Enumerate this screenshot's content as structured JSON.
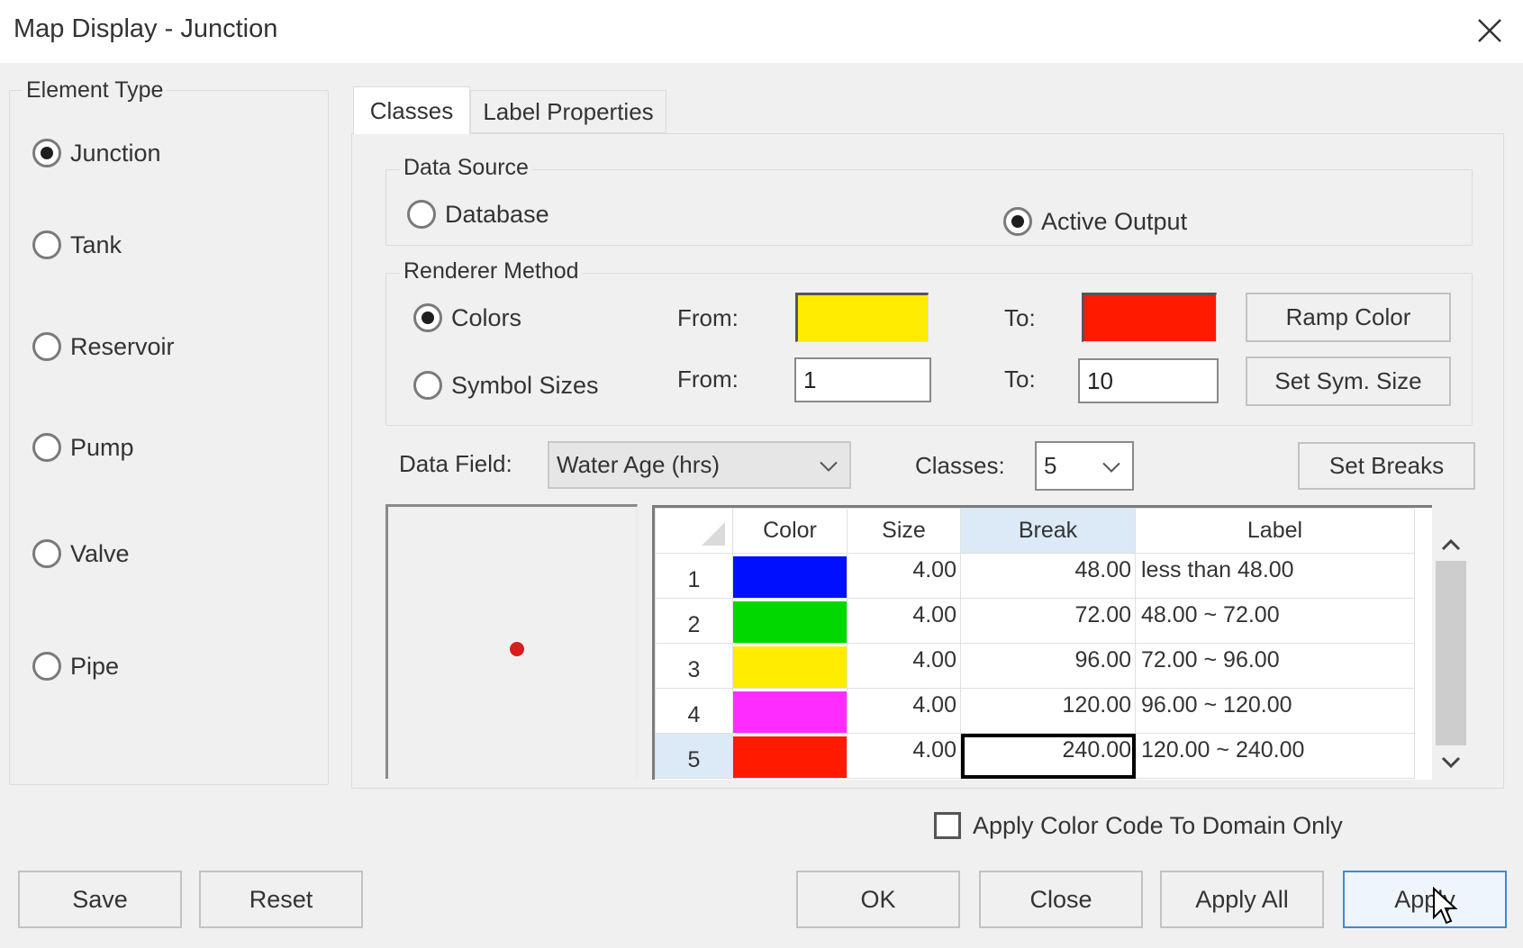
{
  "window": {
    "title": "Map Display  - Junction",
    "close_icon": "close-icon"
  },
  "element_type": {
    "label": "Element Type",
    "options": [
      {
        "label": "Junction",
        "checked": true
      },
      {
        "label": "Tank",
        "checked": false
      },
      {
        "label": "Reservoir",
        "checked": false
      },
      {
        "label": "Pump",
        "checked": false
      },
      {
        "label": "Valve",
        "checked": false
      },
      {
        "label": "Pipe",
        "checked": false
      }
    ]
  },
  "tabs": [
    {
      "label": "Classes",
      "active": true
    },
    {
      "label": "Label Properties",
      "active": false
    }
  ],
  "data_source": {
    "label": "Data Source",
    "options": [
      {
        "label": "Database",
        "checked": false
      },
      {
        "label": "Active Output",
        "checked": true
      }
    ]
  },
  "renderer": {
    "label": "Renderer Method",
    "colors_label": "Colors",
    "colors_checked": true,
    "symbol_sizes_label": "Symbol Sizes",
    "symbol_sizes_checked": false,
    "from_label": "From:",
    "to_label": "To:",
    "color_from": "#ffec00",
    "color_to": "#ff1a00",
    "size_from": "1",
    "size_to": "10",
    "ramp_color_button": "Ramp Color",
    "set_sym_size_button": "Set Sym. Size"
  },
  "data_field": {
    "label": "Data Field:",
    "value": "Water Age (hrs)"
  },
  "classes": {
    "label": "Classes:",
    "value": "5",
    "set_breaks_button": "Set Breaks"
  },
  "preview": {
    "symbol_color": "#d81d1d"
  },
  "grid": {
    "columns": [
      "",
      "Color",
      "Size",
      "Break",
      "Label"
    ],
    "selected_column": "Break",
    "selected_row": 5,
    "rows": [
      {
        "index": "1",
        "color": "#0010ff",
        "size": "4.00",
        "break": "48.00",
        "label": "less than 48.00"
      },
      {
        "index": "2",
        "color": "#00d800",
        "size": "4.00",
        "break": "72.00",
        "label": "48.00 ~ 72.00"
      },
      {
        "index": "3",
        "color": "#ffec00",
        "size": "4.00",
        "break": "96.00",
        "label": "72.00 ~ 96.00"
      },
      {
        "index": "4",
        "color": "#ff2cff",
        "size": "4.00",
        "break": "120.00",
        "label": "96.00 ~ 120.00"
      },
      {
        "index": "5",
        "color": "#ff1a00",
        "size": "4.00",
        "break": "240.00",
        "label": "120.00 ~ 240.00"
      }
    ]
  },
  "apply_domain_only": {
    "label": "Apply Color Code To Domain Only",
    "checked": false
  },
  "buttons": {
    "save": "Save",
    "reset": "Reset",
    "ok": "OK",
    "close": "Close",
    "apply_all": "Apply All",
    "apply": "Apply"
  }
}
